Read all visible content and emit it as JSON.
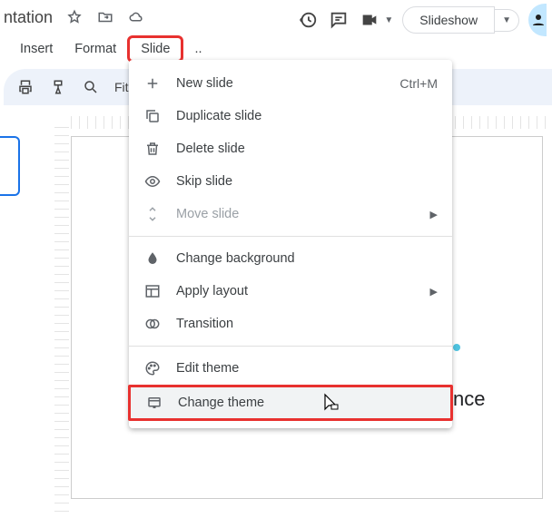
{
  "header": {
    "title_partial": "ntation"
  },
  "menubar": {
    "partial": "",
    "insert": "Insert",
    "format": "Format",
    "slide": "Slide",
    "more": ".."
  },
  "toolbar": {
    "zoom_label": "Fit"
  },
  "actions": {
    "slideshow": "Slideshow"
  },
  "dropdown": {
    "new_slide": "New slide",
    "new_slide_shortcut": "Ctrl+M",
    "duplicate": "Duplicate slide",
    "delete": "Delete slide",
    "skip": "Skip slide",
    "move": "Move slide",
    "background": "Change background",
    "layout": "Apply layout",
    "transition": "Transition",
    "edit_theme": "Edit theme",
    "change_theme": "Change theme"
  },
  "slide_content": {
    "placeholder_partial": "nce"
  }
}
